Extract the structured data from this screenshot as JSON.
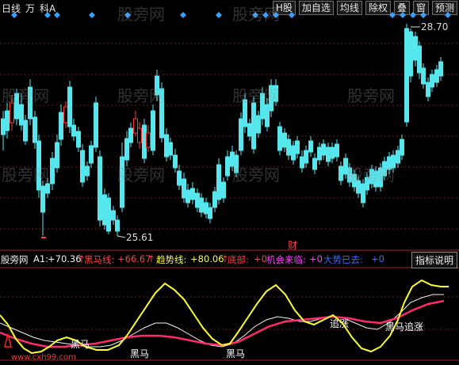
{
  "toolbar": {
    "left": [
      "日线",
      "万",
      "科A"
    ],
    "right": [
      "H股",
      "加自选",
      "均线",
      "除权",
      "叠",
      "窗",
      "预测"
    ]
  },
  "watermark": "股旁网",
  "price_chart": {
    "high_label": "28.70",
    "low_label": "25.61",
    "event_marker": "财",
    "up_color": "#ff3b3b",
    "down_color": "#55e6ee",
    "diamond_color": "#3aa0ff"
  },
  "indicator": {
    "name": "股旁网",
    "items": [
      {
        "label": "A1:",
        "value": "+70.36",
        "color": "#f0f0f0"
      },
      {
        "label": "黑马线:",
        "value": "+66.67",
        "color": "#ff4444",
        "arrow": "↑"
      },
      {
        "label": "趋势线:",
        "value": "+80.06",
        "color": "#ffff44",
        "arrow": "↑"
      },
      {
        "label": "底部:",
        "value": "+0",
        "color": "#ff4444"
      },
      {
        "label": "机会来临:",
        "value": "+0",
        "color": "#ff44ff"
      },
      {
        "label": "大势已去:",
        "value": "+0",
        "color": "#3f6bff"
      }
    ],
    "help_label": "指标说明"
  },
  "annotations": {
    "heima_labels": [
      "黑马",
      "黑马",
      "黑马"
    ],
    "zhuizhang": "追涨",
    "heima_zizhang": "黑马追涨",
    "site": "www.cxh99.com"
  }
}
